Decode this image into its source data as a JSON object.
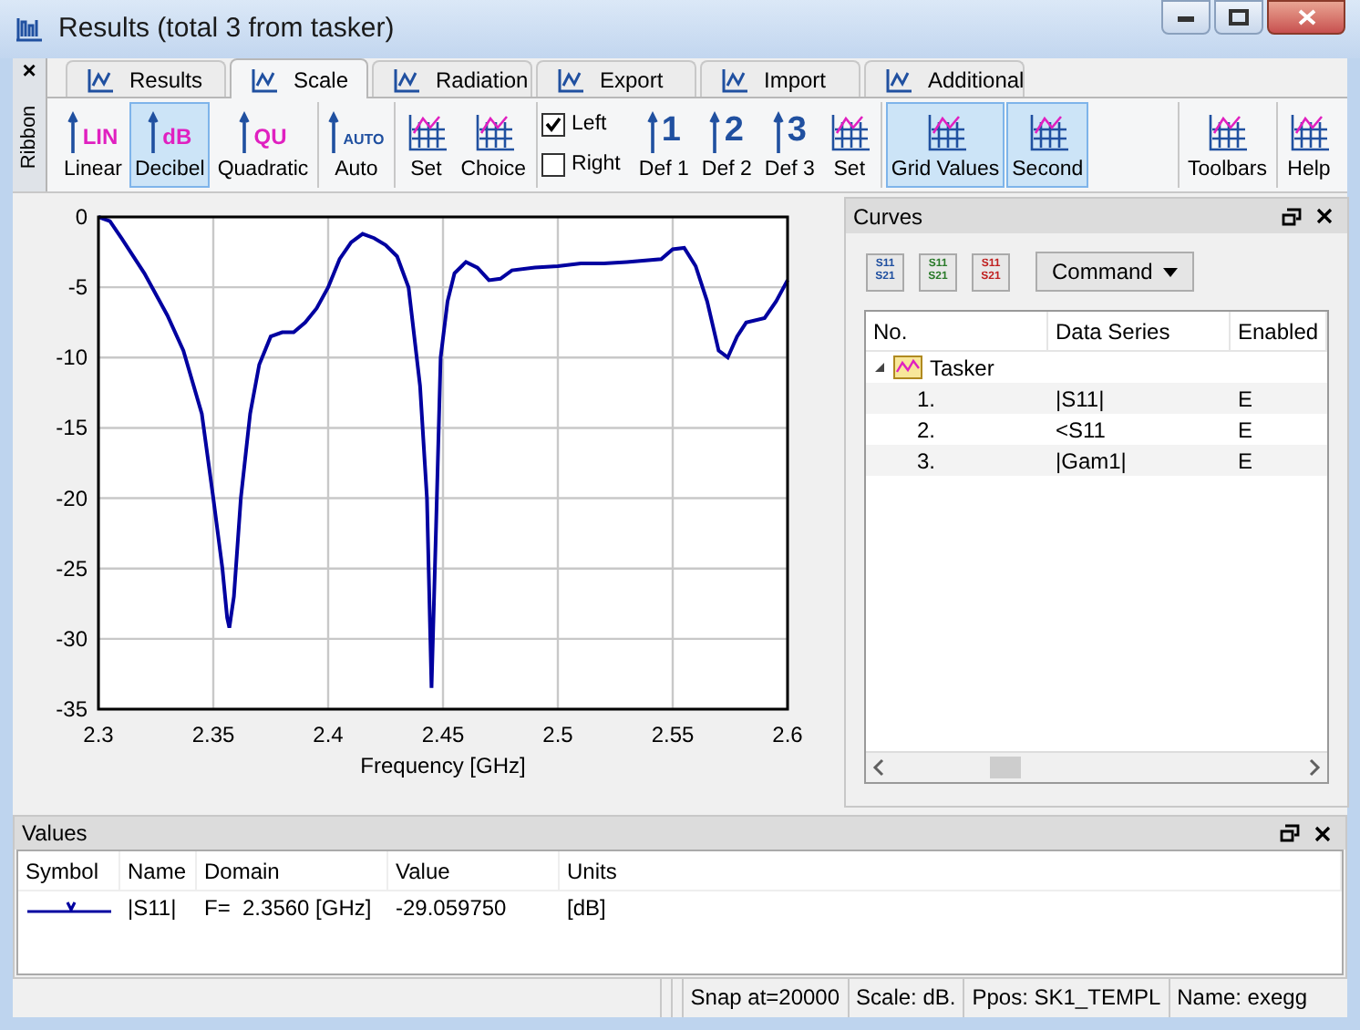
{
  "window": {
    "title": "Results (total 3 from tasker)"
  },
  "ribbon": {
    "label": "Ribbon",
    "close": "×"
  },
  "tabs": [
    {
      "label": "Results",
      "selected": false
    },
    {
      "label": "Scale",
      "selected": true
    },
    {
      "label": "Radiation",
      "selected": false
    },
    {
      "label": "Export",
      "selected": false
    },
    {
      "label": "Import",
      "selected": false
    },
    {
      "label": "Additional",
      "selected": false
    }
  ],
  "toolbar": [
    [
      {
        "kind": "button",
        "label": "Linear",
        "badge": "LIN",
        "selected": false
      },
      {
        "kind": "button",
        "label": "Decibel",
        "badge": "dB",
        "selected": true
      },
      {
        "kind": "button",
        "label": "Quadratic",
        "badge": "QU",
        "selected": false
      }
    ],
    [
      {
        "kind": "button",
        "label": "Auto",
        "badge": "AUTO",
        "selected": false
      }
    ],
    [
      {
        "kind": "button",
        "label": "Set",
        "selected": false
      },
      {
        "kind": "button",
        "label": "Choice",
        "selected": false
      }
    ],
    [
      {
        "kind": "check",
        "label": "Left",
        "checked": true
      },
      {
        "kind": "check",
        "label": "Right",
        "checked": false
      },
      {
        "kind": "button",
        "label": "Def 1",
        "badge": "1",
        "selected": false
      },
      {
        "kind": "button",
        "label": "Def 2",
        "badge": "2",
        "selected": false
      },
      {
        "kind": "button",
        "label": "Def 3",
        "badge": "3",
        "selected": false
      },
      {
        "kind": "button",
        "label": "Set",
        "selected": false
      }
    ],
    [
      {
        "kind": "button",
        "label": "Grid Values",
        "selected": true
      },
      {
        "kind": "button",
        "label": "Second",
        "selected": true
      }
    ],
    [
      {
        "kind": "spacer"
      }
    ],
    [
      {
        "kind": "button",
        "label": "Toolbars",
        "selected": false
      }
    ],
    [
      {
        "kind": "button",
        "label": "Help",
        "selected": false
      }
    ]
  ],
  "chart_data": {
    "type": "line",
    "grid": true,
    "xlabel": "Frequency [GHz]",
    "xlim": [
      2.3,
      2.6
    ],
    "ylim": [
      -35,
      0
    ],
    "xticks": [
      2.3,
      2.35,
      2.4,
      2.45,
      2.5,
      2.55,
      2.6
    ],
    "yticks": [
      0,
      -5,
      -10,
      -15,
      -20,
      -25,
      -30,
      -35
    ],
    "x": [
      2.3,
      2.305,
      2.31,
      2.32,
      2.33,
      2.337,
      2.345,
      2.35,
      2.354,
      2.356,
      2.357,
      2.359,
      2.362,
      2.366,
      2.37,
      2.375,
      2.38,
      2.385,
      2.39,
      2.395,
      2.4,
      2.405,
      2.41,
      2.415,
      2.42,
      2.425,
      2.43,
      2.435,
      2.44,
      2.443,
      2.445,
      2.447,
      2.449,
      2.452,
      2.455,
      2.46,
      2.465,
      2.47,
      2.475,
      2.48,
      2.49,
      2.5,
      2.51,
      2.52,
      2.53,
      2.545,
      2.55,
      2.555,
      2.56,
      2.565,
      2.57,
      2.574,
      2.578,
      2.582,
      2.59,
      2.595,
      2.6
    ],
    "series": [
      {
        "color": "#0000a0",
        "values": [
          0,
          -0.3,
          -1.5,
          -4,
          -7,
          -9.5,
          -14,
          -20,
          -25,
          -28.5,
          -29.2,
          -27,
          -20,
          -14,
          -10.5,
          -8.5,
          -8.2,
          -8.2,
          -7.5,
          -6.5,
          -5,
          -3,
          -1.8,
          -1.2,
          -1.5,
          -2,
          -2.8,
          -5,
          -12,
          -20,
          -33.5,
          -22,
          -10,
          -6,
          -4,
          -3.2,
          -3.6,
          -4.5,
          -4.4,
          -3.8,
          -3.6,
          -3.5,
          -3.3,
          -3.3,
          -3.2,
          -3,
          -2.3,
          -2.2,
          -3.5,
          -6,
          -9.5,
          -10,
          -8.5,
          -7.5,
          -7.2,
          -6,
          -4.5
        ]
      }
    ]
  },
  "curves": {
    "title": "Curves",
    "tools": [
      {
        "top": "S11",
        "bottom": "S21"
      },
      {
        "top": "S11",
        "bottom": "S21"
      },
      {
        "top": "S11",
        "bottom": "S21"
      }
    ],
    "command": "Command",
    "columns": [
      "No.",
      "Data Series",
      "Enabled"
    ],
    "tree": [
      {
        "label": "Tasker",
        "expanded": true,
        "children": [
          {
            "no": "1.",
            "series": "|S11|",
            "enabled": "E"
          },
          {
            "no": "2.",
            "series": "<S11",
            "enabled": "E"
          },
          {
            "no": "3.",
            "series": "|Gam1|",
            "enabled": "E"
          }
        ]
      }
    ]
  },
  "values": {
    "title": "Values",
    "columns": [
      "Symbol",
      "Name",
      "Domain",
      "Value",
      "Units"
    ],
    "rows": [
      {
        "name": "|S11|",
        "domain": "F=  2.3560 [GHz]",
        "value": "-29.059750",
        "units": "[dB]"
      }
    ]
  },
  "status_bar": [
    "Snap at=20000",
    "Scale: dB.",
    "Ppos: SK1_TEMPL",
    "Name: exegg"
  ]
}
